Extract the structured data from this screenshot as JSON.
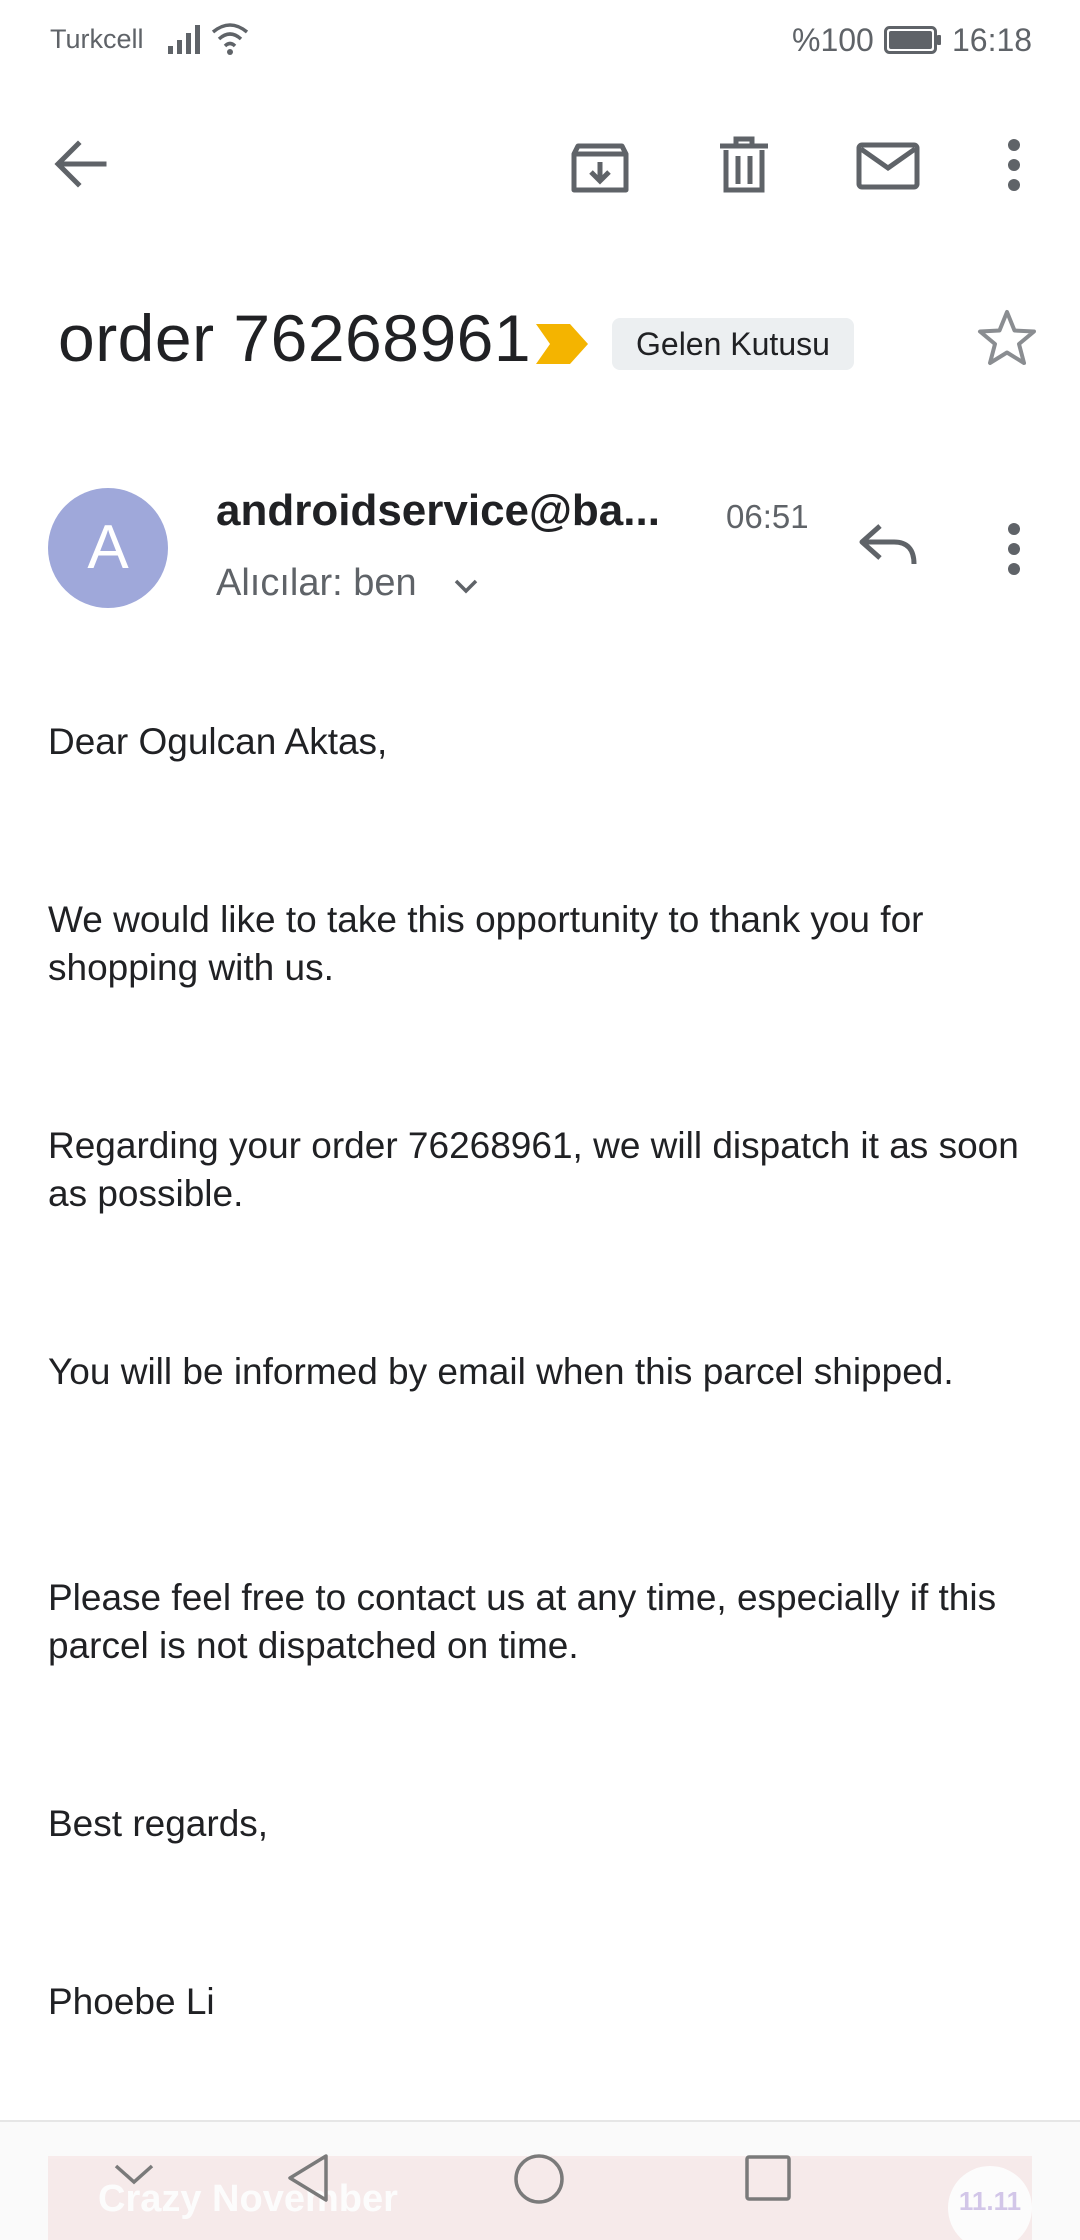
{
  "status_bar": {
    "carrier": "Turkcell",
    "battery_percent": "%100",
    "time": "16:18"
  },
  "toolbar": {
    "icons": [
      "back-arrow-icon",
      "archive-icon",
      "delete-icon",
      "mark-unread-icon",
      "more-vert-icon"
    ]
  },
  "email": {
    "subject": "order 76268961",
    "label": "Gelen Kutusu",
    "important": true,
    "starred": false,
    "sender": {
      "initial": "A",
      "name": "androidservice@ba...",
      "time": "06:51",
      "recipients": "Alıcılar: ben"
    },
    "body": [
      "Dear Ogulcan Aktas,",
      "We would like to take this opportunity to thank you for shopping with us.",
      "Regarding your order 76268961, we will dispatch it as soon as possible.",
      "You will be informed by email when this parcel shipped.",
      "Please feel free to contact us at any time, especially if this parcel is not dispatched on time.",
      "Best regards,",
      "Phoebe Li"
    ]
  },
  "ad": {
    "text": "Crazy November",
    "badge": "11.11"
  },
  "colors": {
    "avatar": "#9fa8da",
    "importance": "#f4b400",
    "chip": "#eceff1",
    "icon": "#5f6368"
  }
}
